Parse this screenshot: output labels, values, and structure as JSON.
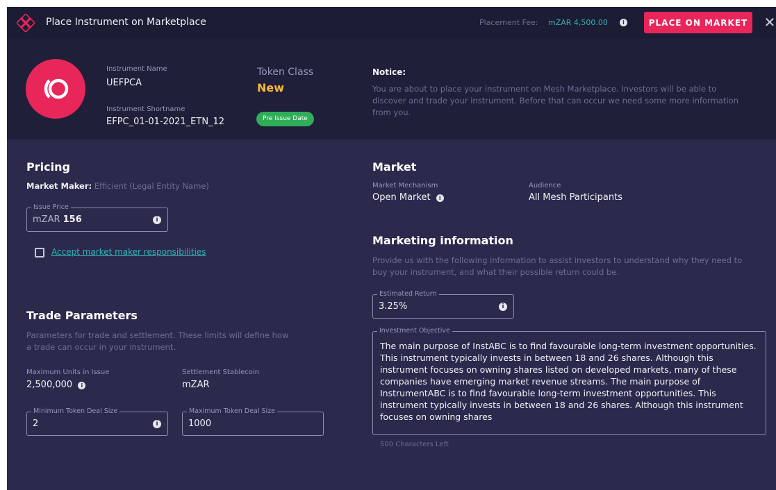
{
  "header": {
    "title": "Place Instrument on Marketplace",
    "fee_label": "Placement Fee:",
    "fee_value": "mZAR 4,500.00",
    "place_button": "PLACE ON MARKET",
    "close_symbol": "✕"
  },
  "instrument": {
    "name_label": "Instrument Name",
    "name": "UEFPCA",
    "shortname_label": "Instrument Shortname",
    "shortname": "EFPC_01-01-2021_ETN_12",
    "token_class_label": "Token Class",
    "token_class": "New",
    "status_badge": "Pre Issue Date"
  },
  "notice": {
    "title": "Notice:",
    "text": "You are about to place your instrument on Mesh Marketplace. Investors will be able to discover and trade your instrument. Before that can occur we need some more information from you."
  },
  "pricing": {
    "title": "Pricing",
    "market_maker_label": "Market Maker:",
    "market_maker_value": "Efficient (Legal Entity Name)",
    "issue_price_label": "Issue Price",
    "issue_price_currency": "mZAR",
    "issue_price_value": "156",
    "accept_link": "Accept market maker responsibilities"
  },
  "trade": {
    "title": "Trade Parameters",
    "description": "Parameters for trade and settlement. These limits will define how a trade can occur in your instrument.",
    "max_units_label": "Maximum Units in Issue",
    "max_units_value": "2,500,000",
    "stablecoin_label": "Settlement Stablecoin",
    "stablecoin_value": "mZAR",
    "min_deal_label": "Minimum Token Deal Size",
    "min_deal_value": "2",
    "max_deal_label": "Maximum Token Deal Size",
    "max_deal_value": "1000"
  },
  "market": {
    "title": "Market",
    "mechanism_label": "Market Mechanism",
    "mechanism_value": "Open Market",
    "audience_label": "Audience",
    "audience_value": "All Mesh Participants"
  },
  "marketing": {
    "title": "Marketing information",
    "description": "Provide us with the following information to assist investors to understand why they need to buy your instrument, and what their possible return could be.",
    "est_return_label": "Estimated Return",
    "est_return_value": "3.25%",
    "objective_label": "Investment Objective",
    "objective_text": "The main purpose of InstABC is to find favourable long-term investment opportunities. This instrument typically invests in between 18 and 26 shares. Although this instrument focuses on owning shares listed on developed markets, many of these companies have emerging market revenue streams. The main purpose of InstrumentABC is to find favourable long-term investment opportunities. This instrument typically invests in between 18 and 26 shares. Although this instrument focuses on owning shares",
    "chars_left": "500 Characters Left"
  },
  "colors": {
    "accent": "#e8265a",
    "link": "#2fb4b8",
    "token_class": "#f5b73a",
    "badge": "#2fae58",
    "panel": "#2b2a4c",
    "header": "#1c1c34"
  },
  "icons": {
    "logo": "mesh-logo-icon",
    "instrument_avatar": "instrument-logo-icon",
    "info": "info-icon",
    "close": "close-icon",
    "checkbox": "checkbox-icon"
  }
}
